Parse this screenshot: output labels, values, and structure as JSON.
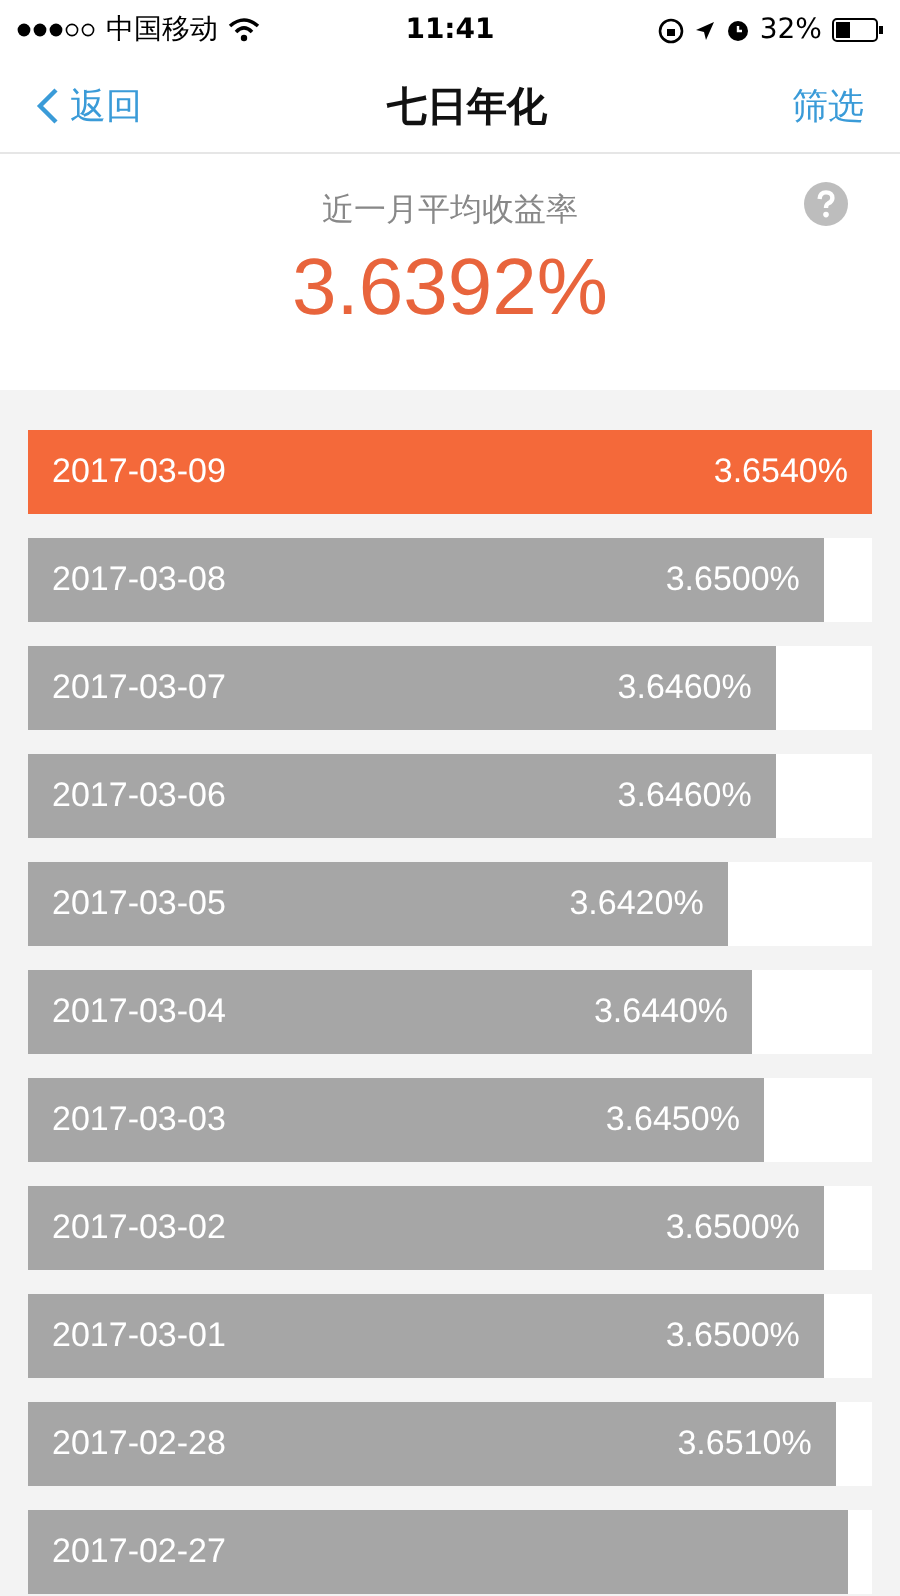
{
  "status_bar": {
    "carrier": "中国移动",
    "time": "11:41",
    "battery": "32%"
  },
  "nav": {
    "back": "返回",
    "title": "七日年化",
    "filter": "筛选"
  },
  "summary": {
    "label": "近一月平均收益率",
    "value": "3.6392%"
  },
  "rows": [
    {
      "date": "2017-03-09",
      "value": "3.6540%",
      "level": 1.0,
      "selected": true
    },
    {
      "date": "2017-03-08",
      "value": "3.6500%",
      "level": 0.943,
      "selected": false
    },
    {
      "date": "2017-03-07",
      "value": "3.6460%",
      "level": 0.886,
      "selected": false
    },
    {
      "date": "2017-03-06",
      "value": "3.6460%",
      "level": 0.886,
      "selected": false
    },
    {
      "date": "2017-03-05",
      "value": "3.6420%",
      "level": 0.829,
      "selected": false
    },
    {
      "date": "2017-03-04",
      "value": "3.6440%",
      "level": 0.858,
      "selected": false
    },
    {
      "date": "2017-03-03",
      "value": "3.6450%",
      "level": 0.872,
      "selected": false
    },
    {
      "date": "2017-03-02",
      "value": "3.6500%",
      "level": 0.943,
      "selected": false
    },
    {
      "date": "2017-03-01",
      "value": "3.6500%",
      "level": 0.943,
      "selected": false
    },
    {
      "date": "2017-02-28",
      "value": "3.6510%",
      "level": 0.957,
      "selected": false
    },
    {
      "date": "2017-02-27",
      "level": 0.972,
      "selected": false
    }
  ]
}
